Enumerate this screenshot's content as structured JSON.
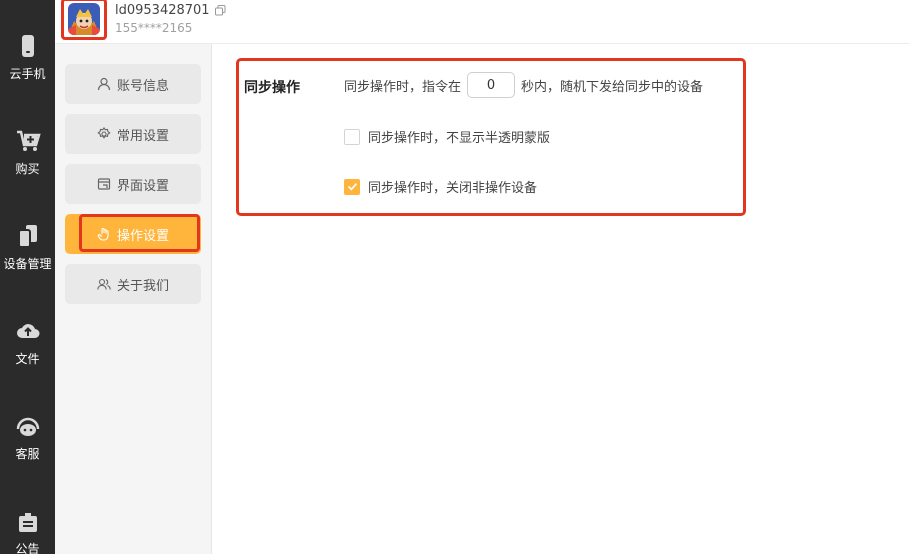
{
  "nav": {
    "items": [
      {
        "label": "云手机",
        "icon": "phone-icon"
      },
      {
        "label": "购买",
        "icon": "cart-icon"
      },
      {
        "label": "设备管理",
        "icon": "devices-icon"
      },
      {
        "label": "文件",
        "icon": "cloud-upload-icon"
      },
      {
        "label": "客服",
        "icon": "headset-icon"
      },
      {
        "label": "公告",
        "icon": "notice-icon"
      }
    ]
  },
  "header": {
    "user_id": "ld0953428701",
    "phone": "155****2165"
  },
  "menu": {
    "items": [
      {
        "label": "账号信息",
        "icon": "user-icon"
      },
      {
        "label": "常用设置",
        "icon": "gear-icon"
      },
      {
        "label": "界面设置",
        "icon": "window-icon"
      },
      {
        "label": "操作设置",
        "icon": "hand-icon",
        "active": true
      },
      {
        "label": "关于我们",
        "icon": "users-icon"
      }
    ]
  },
  "settings": {
    "title": "同步操作",
    "row1_prefix": "同步操作时，指令在",
    "row1_value": "0",
    "row1_suffix": "秒内，随机下发给同步中的设备",
    "option1_label": "同步操作时，不显示半透明蒙版",
    "option1_checked": false,
    "option2_label": "同步操作时，关闭非操作设备",
    "option2_checked": true
  },
  "colors": {
    "accent": "#ffb43b",
    "highlight": "#e2371e",
    "nav_bg": "#2b2b2b"
  }
}
